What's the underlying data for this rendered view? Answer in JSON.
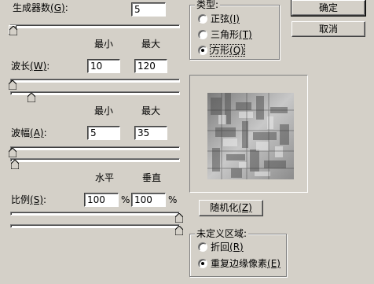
{
  "generators": {
    "label": "生成器数",
    "hotkey": "(G)",
    "colon": ":",
    "value": "5"
  },
  "minmax_headers": {
    "min": "最小",
    "max": "最大"
  },
  "wavelength": {
    "label": "波长",
    "hotkey": "(W)",
    "colon": ":",
    "min": "10",
    "max": "120"
  },
  "amplitude": {
    "label": "波幅",
    "hotkey": "(A)",
    "colon": ":",
    "min": "5",
    "max": "35"
  },
  "scale": {
    "header_horizontal": "水平",
    "header_vertical": "垂直",
    "label": "比例",
    "hotkey": "(S)",
    "colon": ":",
    "horizontal": "100",
    "vertical": "100",
    "unit": "%"
  },
  "type_group": {
    "title": "类型",
    "colon": ":",
    "options": [
      {
        "label": "正弦",
        "hotkey": "(I)",
        "selected": false
      },
      {
        "label": "三角形",
        "hotkey": "(T)",
        "selected": false
      },
      {
        "label": "方形",
        "hotkey": "(Q)",
        "selected": true
      }
    ]
  },
  "buttons": {
    "ok": "确定",
    "cancel": "取消",
    "randomize": "随机化",
    "randomize_hotkey": "(Z)"
  },
  "undefined_group": {
    "title": "未定义区域",
    "colon": ":",
    "options": [
      {
        "label": "折回",
        "hotkey": "(R)",
        "selected": false
      },
      {
        "label": "重复边缘像素",
        "hotkey": "(E)",
        "selected": true
      }
    ]
  },
  "sliders": {
    "generators": 0.0,
    "wavelength_min": 0.0,
    "wavelength_max": 0.12,
    "amplitude_min": 0.0,
    "amplitude_max": 0.02,
    "scale_horizontal": 1.0,
    "scale_vertical": 1.0
  }
}
